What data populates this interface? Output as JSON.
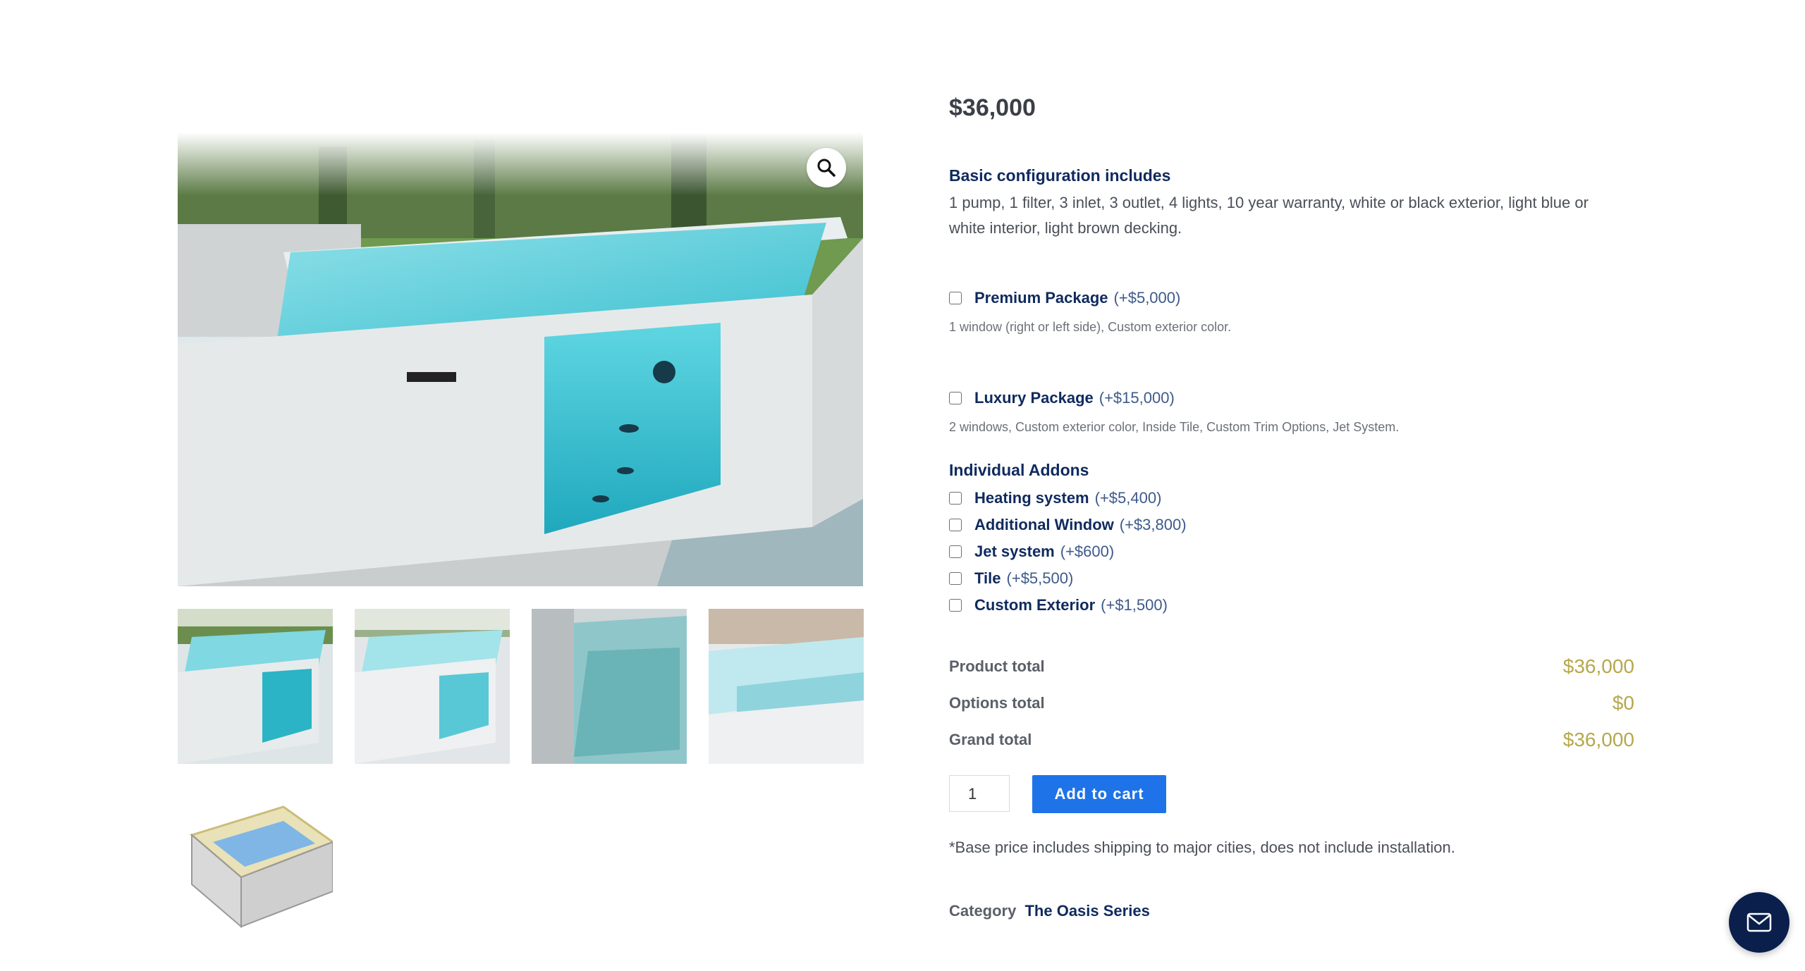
{
  "product": {
    "price": "$36,000"
  },
  "basic": {
    "title": "Basic configuration includes",
    "text": "1 pump, 1 filter, 3 inlet, 3 outlet, 4 lights, 10 year warranty, white or black exterior, light blue or white interior, light brown decking."
  },
  "packages": [
    {
      "name": "Premium Package",
      "price": "(+$5,000)",
      "desc": "1 window (right or left side), Custom exterior color."
    },
    {
      "name": "Luxury Package",
      "price": "(+$15,000)",
      "desc": "2 windows, Custom exterior color, Inside Tile, Custom Trim Options, Jet System."
    }
  ],
  "addons": {
    "title": "Individual Addons",
    "items": [
      {
        "name": "Heating system",
        "price": "(+$5,400)"
      },
      {
        "name": "Additional Window",
        "price": "(+$3,800)"
      },
      {
        "name": "Jet system",
        "price": "(+$600)"
      },
      {
        "name": "Tile",
        "price": "(+$5,500)"
      },
      {
        "name": "Custom Exterior",
        "price": "(+$1,500)"
      }
    ]
  },
  "totals": {
    "product_label": "Product total",
    "product_value": "$36,000",
    "options_label": "Options total",
    "options_value": "$0",
    "grand_label": "Grand total",
    "grand_value": "$36,000"
  },
  "cart": {
    "quantity": "1",
    "add_label": "Add to cart"
  },
  "note": "*Base price includes shipping to major cities, does not include installation.",
  "category": {
    "label": "Category",
    "value": "The Oasis Series"
  },
  "icons": {
    "zoom": "magnifier-icon",
    "contact": "envelope-icon"
  },
  "colors": {
    "accent": "#1e73e8",
    "heading": "#0f2a5e",
    "totals": "#b5a84c",
    "contact_button": "#0b1f4d"
  }
}
